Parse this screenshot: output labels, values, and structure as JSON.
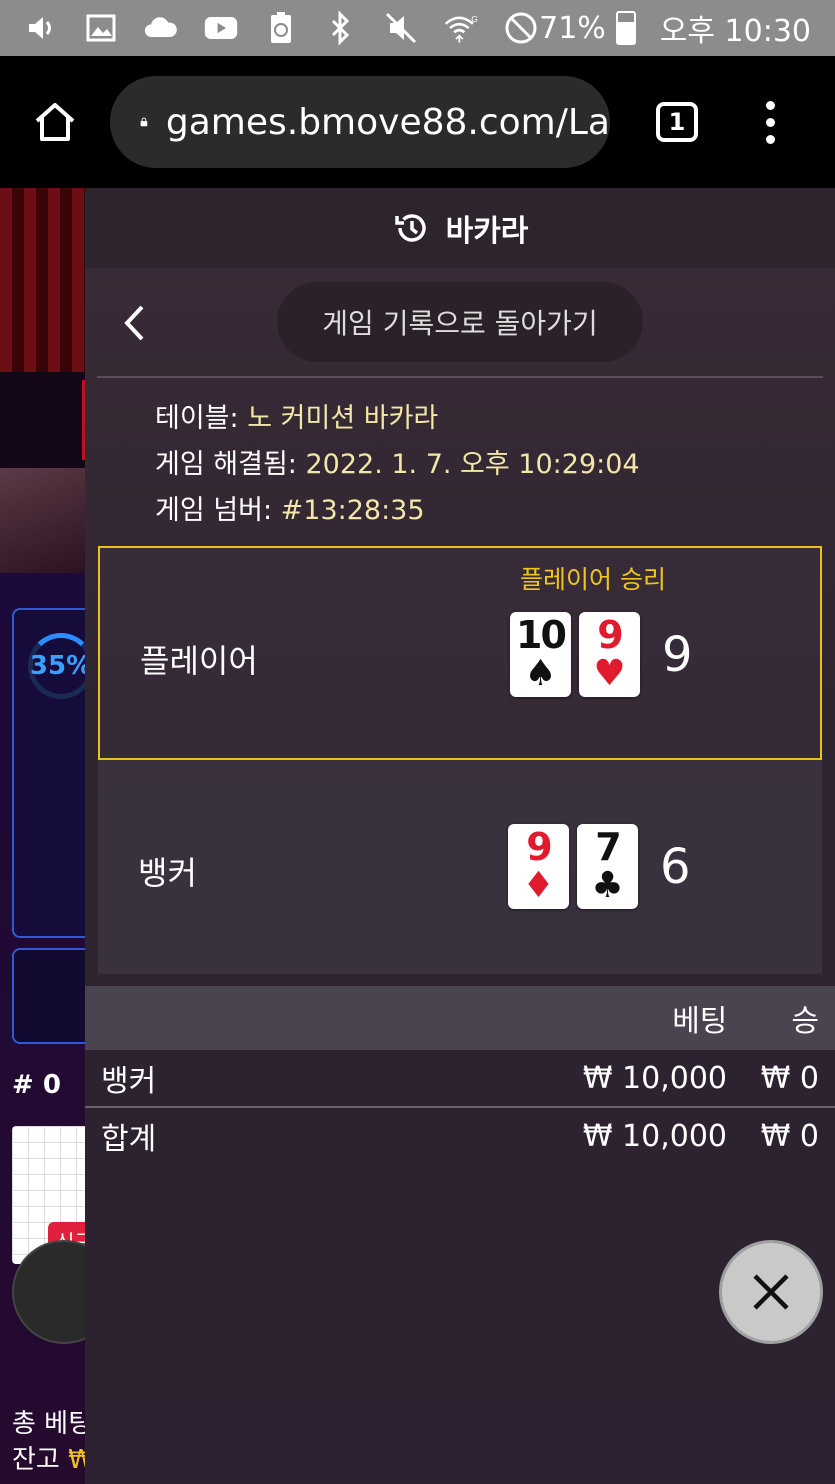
{
  "status_bar": {
    "battery": "71%",
    "time": "오후 10:30",
    "icons": [
      "volume-icon",
      "image-icon",
      "cloud-icon",
      "youtube-icon",
      "battery-saver-icon",
      "bluetooth-icon",
      "mute-icon",
      "wifi-icon",
      "no-disturb-icon"
    ],
    "wifi_label": "G"
  },
  "browser": {
    "url": "games.bmove88.com/La",
    "tab_count": "1"
  },
  "background_game": {
    "progress_label": "35%",
    "round_label": "# 0",
    "new_badge": "신규",
    "total_bet_label": "총 베팅",
    "balance_label": "잔고",
    "currency_symbol": "₩"
  },
  "panel": {
    "title": "바카라",
    "back_button": "게임 기록으로 돌아가기",
    "table_label": "테이블:",
    "table_value": "노 커미션 바카라",
    "resolved_label": "게임 해결됨:",
    "resolved_value": "2022. 1. 7. 오후 10:29:04",
    "number_label": "게임 넘버:",
    "number_value": "#13:28:35",
    "player": {
      "name": "플레이어",
      "win_label": "플레이어 승리",
      "cards": [
        {
          "rank": "10",
          "suit": "♠",
          "color": "black"
        },
        {
          "rank": "9",
          "suit": "♥",
          "color": "red"
        }
      ],
      "score": "9"
    },
    "banker": {
      "name": "뱅커",
      "cards": [
        {
          "rank": "9",
          "suit": "♦",
          "color": "red"
        },
        {
          "rank": "7",
          "suit": "♣",
          "color": "black"
        }
      ],
      "score": "6"
    },
    "bets": {
      "header_bet": "베팅",
      "header_win": "승",
      "rows": [
        {
          "label": "뱅커",
          "bet": "₩ 10,000",
          "win": "₩ 0"
        },
        {
          "label": "합계",
          "bet": "₩ 10,000",
          "win": "₩ 0"
        }
      ]
    }
  },
  "colors": {
    "highlight": "#e8c21a",
    "accent_blue": "#2d5bd8"
  }
}
